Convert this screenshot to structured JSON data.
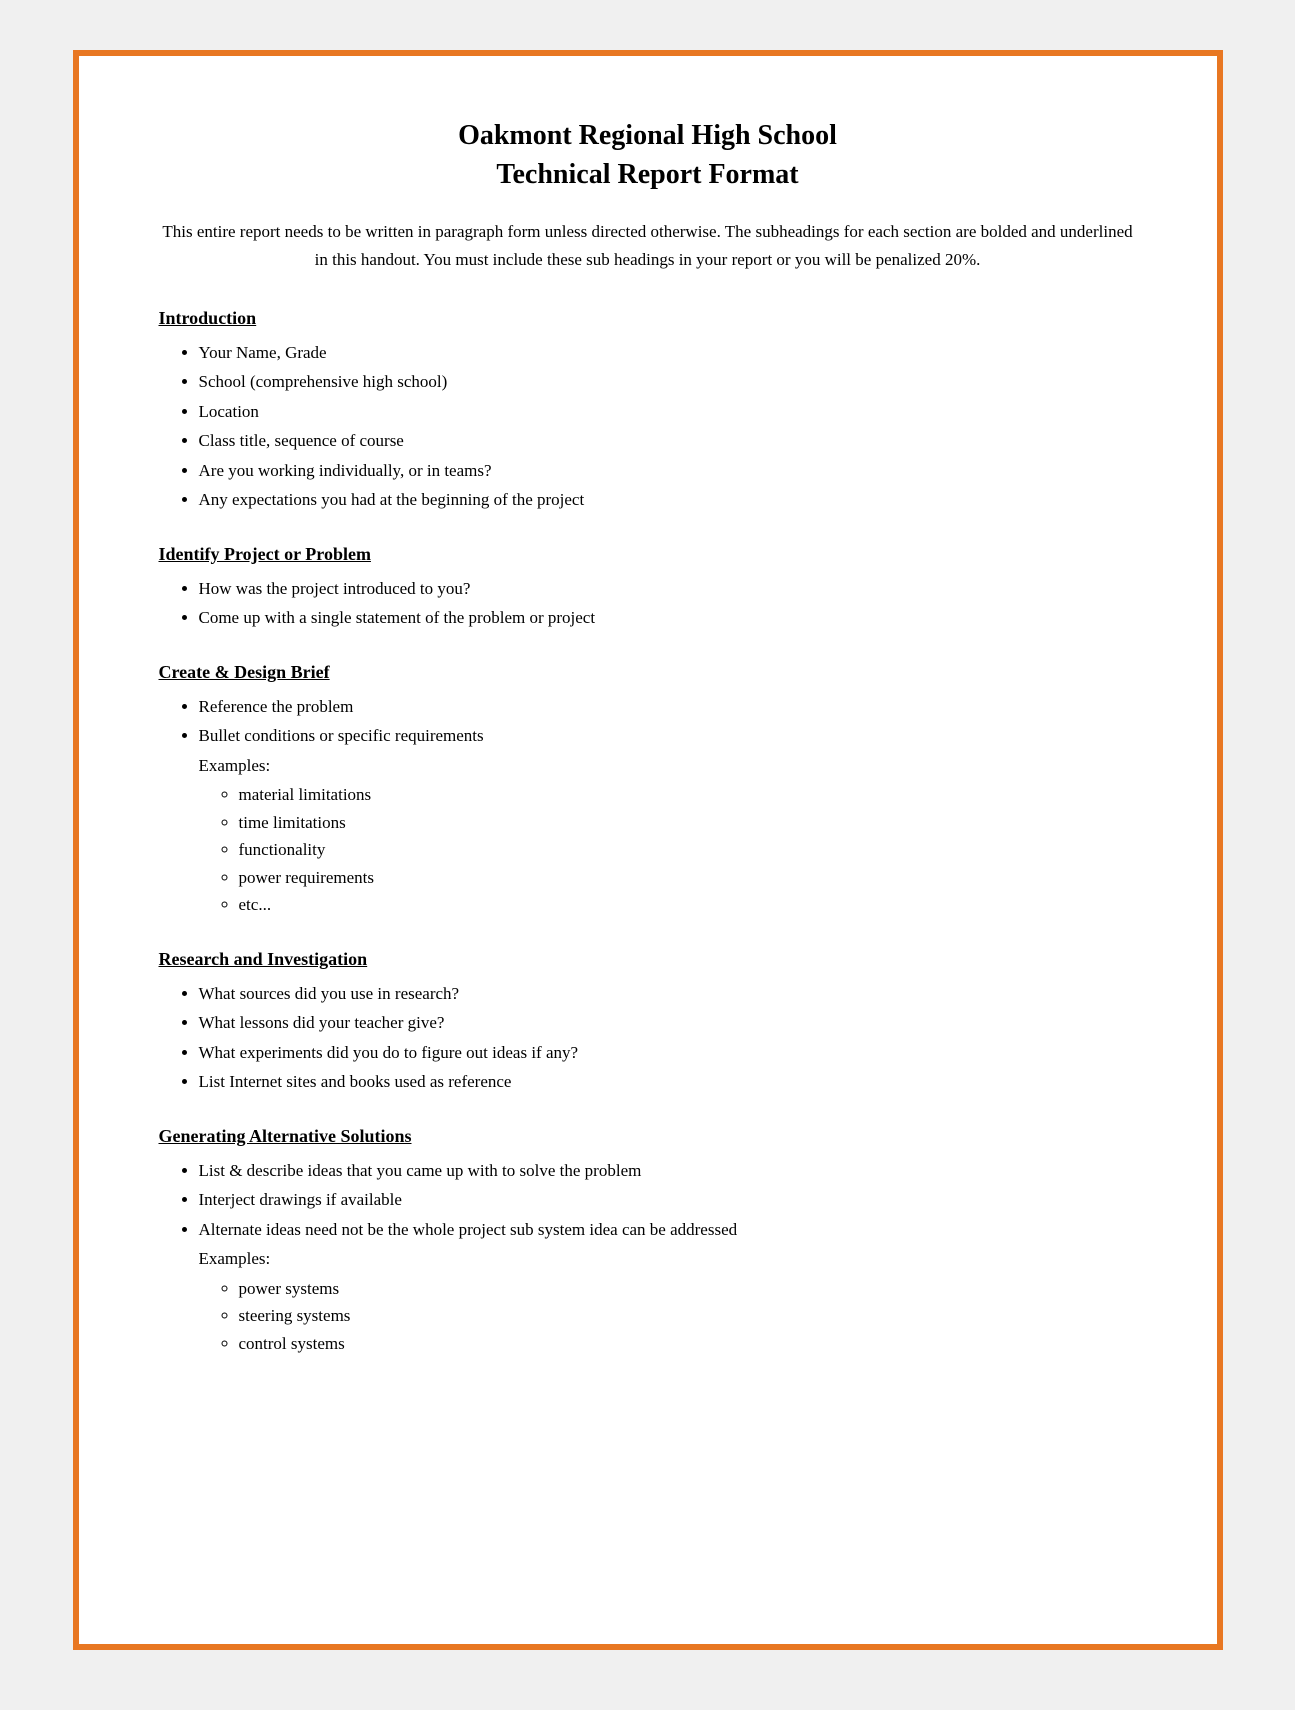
{
  "page": {
    "border_color": "#e87722",
    "title_line1": "Oakmont Regional High School",
    "title_line2": "Technical Report Format",
    "intro": "This entire report needs to be written in paragraph form unless directed otherwise. The subheadings for each section are bolded and underlined in this handout. You must include these sub headings in your report or you will be penalized 20%.",
    "sections": [
      {
        "id": "introduction",
        "heading": "Introduction",
        "bullets": [
          "Your Name, Grade",
          "School (comprehensive high school)",
          "Location",
          "Class title, sequence of course",
          "Are you working individually, or in teams?",
          "Any expectations you had at the beginning of the project"
        ],
        "sub_items": []
      },
      {
        "id": "identify-project",
        "heading": "Identify Project or Problem",
        "bullets": [
          "How was the project introduced to you?",
          "Come up with a single statement of the problem or project"
        ],
        "sub_items": []
      },
      {
        "id": "create-design-brief",
        "heading": "Create & Design Brief",
        "bullets": [
          "Reference the problem",
          "Bullet conditions or specific requirements"
        ],
        "examples_label": "Examples:",
        "sub_items": [
          "material limitations",
          "time limitations",
          "functionality",
          "power requirements",
          "etc..."
        ]
      },
      {
        "id": "research-investigation",
        "heading": "Research and Investigation",
        "bullets": [
          "What sources did you use in research?",
          "What lessons did your teacher give?",
          "What experiments did you do to figure out ideas if any?",
          "List Internet sites and books used as reference"
        ],
        "sub_items": []
      },
      {
        "id": "generating-solutions",
        "heading": "Generating Alternative Solutions",
        "bullets": [
          "List & describe ideas that you came up with to solve the problem",
          "Interject drawings if available",
          "Alternate ideas need not be the whole project sub system idea can be addressed"
        ],
        "examples_label": "Examples:",
        "sub_items": [
          "power systems",
          "steering systems",
          "control systems"
        ]
      }
    ]
  }
}
